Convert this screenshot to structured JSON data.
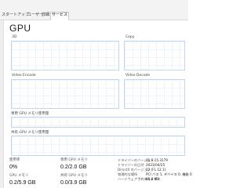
{
  "tabs": [
    {
      "label": "スタートアップ",
      "active": false
    },
    {
      "label": "ユーザー",
      "active": false
    },
    {
      "label": "詳細",
      "active": false
    },
    {
      "label": "サービス",
      "active": true
    }
  ],
  "section": {
    "title": "GPU"
  },
  "graphs": {
    "g3d": {
      "label": "3D",
      "right_label": ""
    },
    "copy": {
      "label": "Copy",
      "right_label": ""
    },
    "video_encode": {
      "label": "Video Encode",
      "right_label": ""
    },
    "video_decode": {
      "label": "Video Decode",
      "right_label": ""
    },
    "dedicated_memory": {
      "label": "専用 GPU メモリ使用量"
    },
    "shared_memory": {
      "label": "共有 GPU メモリ使用量"
    }
  },
  "stats": {
    "utilization": {
      "label": "使用率",
      "value": "0%"
    },
    "dedicated_gpu_memory": {
      "label": "専用 GPU メモリ",
      "value": "0.2/2.0 GB"
    },
    "gpu_memory": {
      "label": "GPU メモリ",
      "value": "0.2/5.9 GB"
    },
    "shared_gpu_memory": {
      "label": "共有 GPU メモリ",
      "value": "0.0/3.9 GB"
    }
  },
  "info": [
    {
      "key": "ドライバーのバージョン",
      "value": "31.0.15.3179"
    },
    {
      "key": "ドライバーの日付",
      "value": "2023/04/25"
    },
    {
      "key": "DirectX のバージョン",
      "value": "12 (FL 12.1)"
    },
    {
      "key": "物理的な場所",
      "value": "PCI バス 1, デバイス 0, 機能 0"
    },
    {
      "key": "ハードウェア予約済みメモリ",
      "value": "45.6 MB"
    }
  ],
  "colors": {
    "graph_border": "#bfd8ee",
    "grid": "#eef4fa"
  }
}
